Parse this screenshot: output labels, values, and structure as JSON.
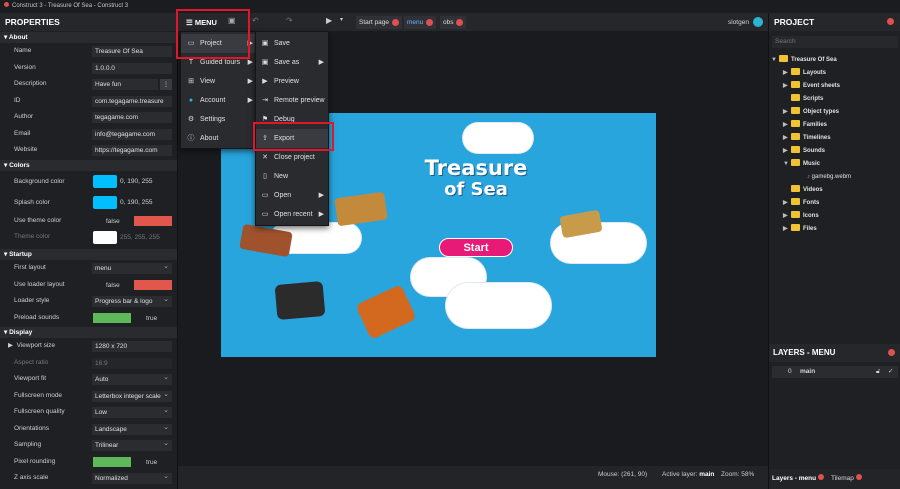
{
  "window": {
    "title": "Construct 3 - Treasure Of Sea - Construct 3"
  },
  "properties": {
    "title": "PROPERTIES",
    "sections": {
      "about": "About",
      "colors": "Colors",
      "startup": "Startup",
      "display": "Display"
    },
    "about": {
      "name_label": "Name",
      "name_value": "Treasure Of Sea",
      "version_label": "Version",
      "version_value": "1.0.0.0",
      "description_label": "Description",
      "description_value": "Have fun",
      "id_label": "ID",
      "id_value": "com.tegagame.treasure",
      "author_label": "Author",
      "author_value": "tegagame.com",
      "email_label": "Email",
      "email_value": "info@tegagame.com",
      "website_label": "Website",
      "website_value": "https://tegagame.com"
    },
    "colors": {
      "bg_label": "Background color",
      "bg_value": "0, 190, 255",
      "splash_label": "Splash color",
      "splash_value": "0, 190, 255",
      "use_theme_label": "Use theme color",
      "use_theme_value": "false",
      "theme_label": "Theme color",
      "theme_value": "255, 255, 255"
    },
    "startup": {
      "first_layout_label": "First layout",
      "first_layout_value": "menu",
      "loader_layout_label": "Use loader layout",
      "loader_layout_value": "false",
      "loader_style_label": "Loader style",
      "loader_style_value": "Progress bar & logo",
      "preload_label": "Preload sounds",
      "preload_value": "true"
    },
    "display": {
      "viewport_label": "Viewport size",
      "viewport_value": "1280 x 720",
      "aspect_label": "Aspect ratio",
      "aspect_value": "16:9",
      "fit_label": "Viewport fit",
      "fit_value": "Auto",
      "fsmode_label": "Fullscreen mode",
      "fsmode_value": "Letterbox integer scale",
      "fsquality_label": "Fullscreen quality",
      "fsquality_value": "Low",
      "orient_label": "Orientations",
      "orient_value": "Landscape",
      "sampling_label": "Sampling",
      "sampling_value": "Trilinear",
      "pixel_label": "Pixel rounding",
      "pixel_value": "true",
      "zaxis_label": "Z axis scale",
      "zaxis_value": "Normalized"
    }
  },
  "toolbar": {
    "menu_label": "MENU",
    "tabs": [
      "Start page",
      "menu",
      "obs"
    ],
    "user": "slotgen"
  },
  "main_menu": {
    "items": [
      "Project",
      "Guided tours",
      "View",
      "Account",
      "Settings",
      "About"
    ]
  },
  "project_menu": {
    "items": [
      "Save",
      "Save as",
      "Preview",
      "Remote preview",
      "Debug",
      "Export",
      "Close project",
      "New",
      "Open",
      "Open recent"
    ]
  },
  "game": {
    "title_line1": "Treasure",
    "title_line2": "of Sea",
    "start_button": "Start"
  },
  "status": {
    "mouse": "Mouse: (261, 90)",
    "active_layer_label": "Active layer:",
    "active_layer_value": "main",
    "zoom": "Zoom: 58%"
  },
  "project_panel": {
    "title": "PROJECT",
    "search_placeholder": "Search",
    "root": "Treasure Of Sea",
    "folders": [
      "Layouts",
      "Event sheets",
      "Scripts",
      "Object types",
      "Families",
      "Timelines",
      "Sounds",
      "Music",
      "Videos",
      "Fonts",
      "Icons",
      "Files"
    ],
    "music_file": "gamebg.webm"
  },
  "layers_panel": {
    "title": "LAYERS - MENU",
    "layer_index": "0",
    "layer_name": "main"
  },
  "bottom_tabs": [
    "Layers - menu",
    "Tilemap"
  ],
  "colors": {
    "accent_red": "#e0162b",
    "canvas_blue": "#29a5dd",
    "swatch_blue": "#00beff"
  }
}
